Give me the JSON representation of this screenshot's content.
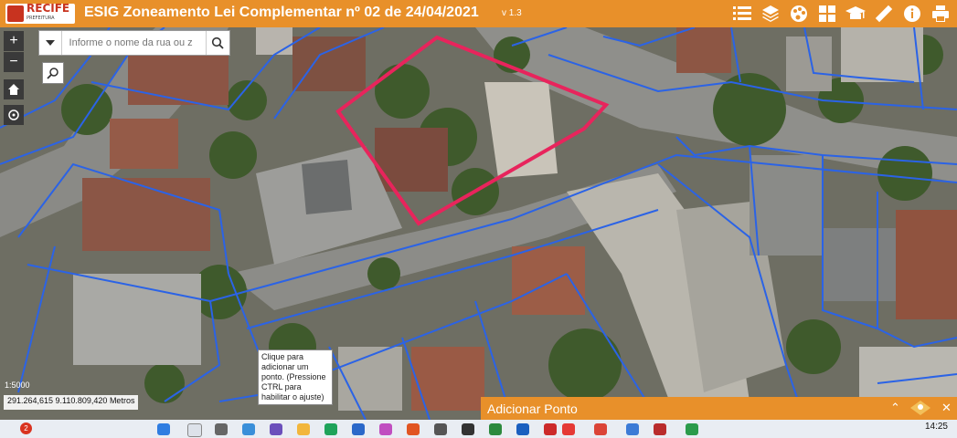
{
  "header": {
    "logo_text": "RECIFE",
    "logo_subtext": "PREFEITURA",
    "title": "ESIG Zoneamento Lei Complementar nº 02 de 24/04/2021",
    "version": "v 1.3"
  },
  "toolbar": {
    "tools": [
      "list-icon",
      "layers-icon",
      "palette-icon",
      "grid-icon",
      "education-icon",
      "ruler-icon",
      "info-icon",
      "print-icon"
    ]
  },
  "search": {
    "placeholder": "Informe o nome da rua ou z"
  },
  "map": {
    "scale": "1:5000",
    "coordinates": "291.264,615 9.110.809,420 Metros",
    "tooltip": "Clique para adicionar um ponto. (Pressione CTRL para habilitar o ajuste)",
    "parcel_line_color": "#2b63e6",
    "highlight_color": "#e8245c"
  },
  "panel": {
    "title": "Adicionar Ponto"
  },
  "taskbar": {
    "badge": "2",
    "time": "14:25"
  },
  "colors": {
    "brand": "#e8902a"
  }
}
